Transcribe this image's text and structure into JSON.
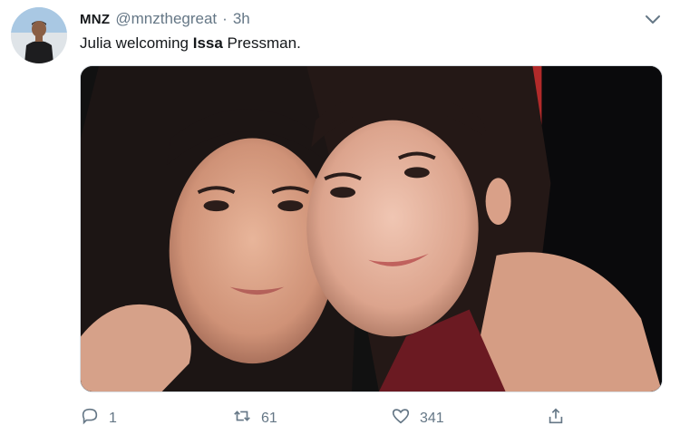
{
  "tweet": {
    "display_name": "MNZ",
    "handle": "@mnzthegreat",
    "separator": "·",
    "time": "3h",
    "text_before": "Julia welcoming ",
    "text_bold": "Issa",
    "text_after": " Pressman.",
    "media_alt": "",
    "actions": {
      "reply_count": "1",
      "retweet_count": "61",
      "like_count": "341"
    }
  },
  "icons": {
    "caret": "chevron-down-icon",
    "reply": "reply-icon",
    "retweet": "retweet-icon",
    "like": "heart-icon",
    "share": "share-icon"
  },
  "colors": {
    "text_primary": "#14171a",
    "text_secondary": "#657786",
    "border": "#d8dde2"
  }
}
